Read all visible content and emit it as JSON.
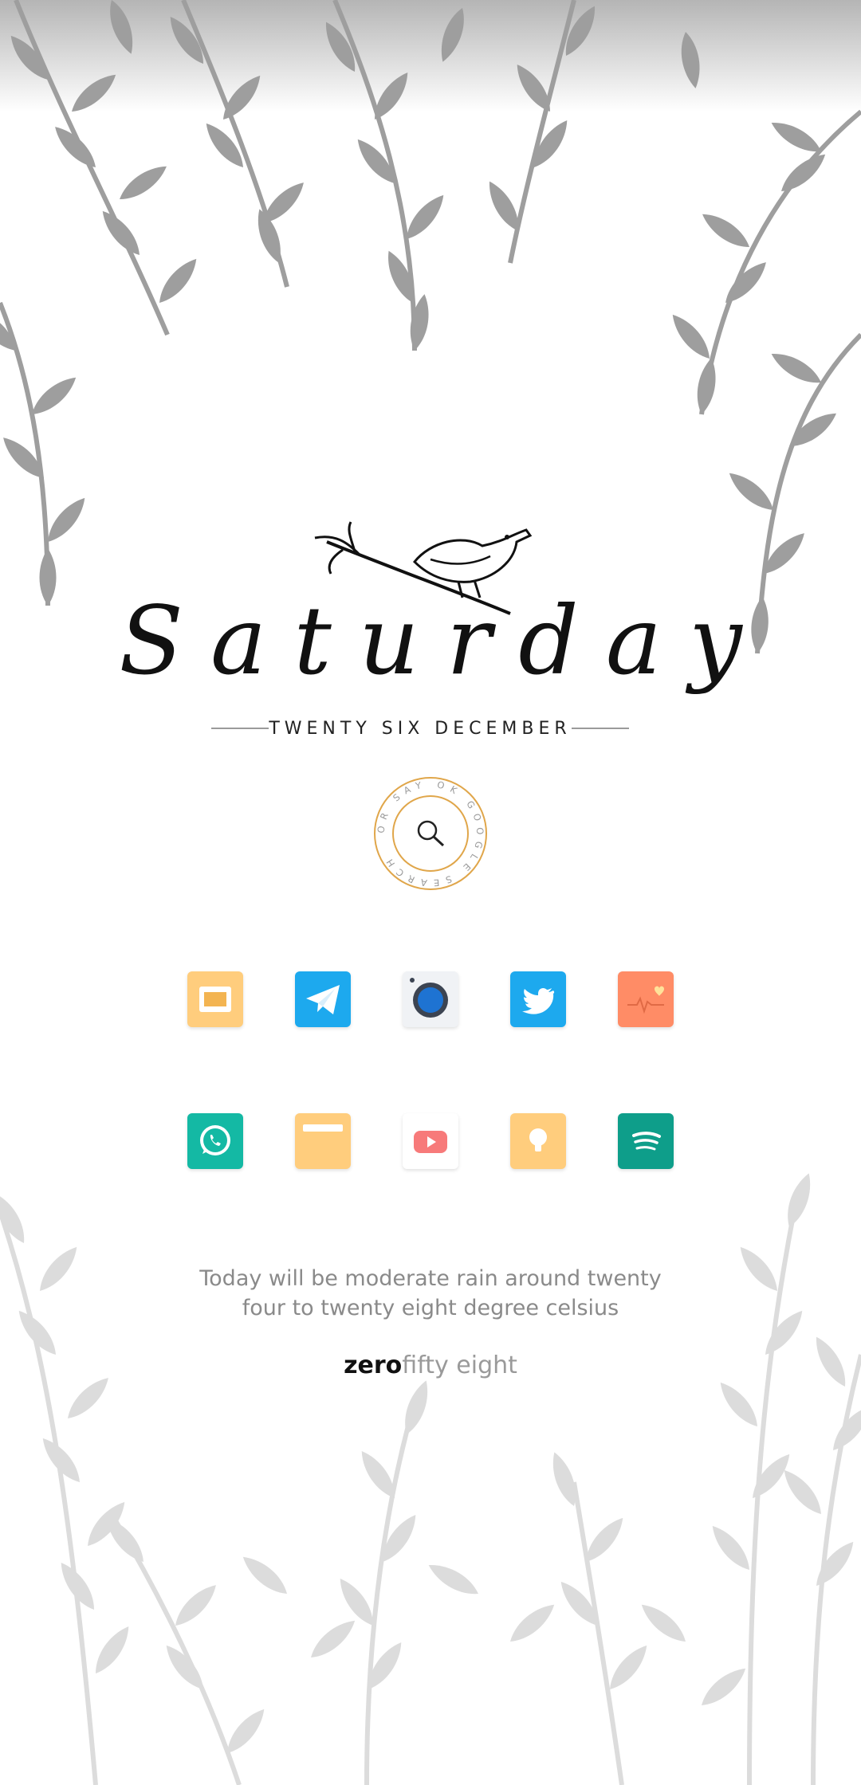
{
  "home": {
    "day": "Saturday",
    "date": "TWENTY SIX DECEMBER",
    "search_ring_text": "OR SAY OK GOOGLE SEARCH",
    "weather_line1": "Today will be moderate rain around twenty",
    "weather_line2": "four to twenty eight degree celsius",
    "time_hour": "zero",
    "time_minute": "fifty eight"
  },
  "apps_row1": [
    {
      "name": "slides-app-icon",
      "bg": "#FFCD7D",
      "icon": "presentation-icon"
    },
    {
      "name": "telegram-app-icon",
      "bg": "#1DA9EE",
      "icon": "paper-plane-icon"
    },
    {
      "name": "camera-app-icon",
      "bg": "#F0F2F5",
      "icon": "camera-lens-icon"
    },
    {
      "name": "twitter-app-icon",
      "bg": "#1DA9EE",
      "icon": "bird-icon"
    },
    {
      "name": "health-app-icon",
      "bg": "#FF8C66",
      "icon": "heart-pulse-icon"
    }
  ],
  "apps_row2": [
    {
      "name": "whatsapp-app-icon",
      "bg": "#14B9A4",
      "icon": "phone-bubble-icon"
    },
    {
      "name": "files-app-icon",
      "bg": "#FFCD7D",
      "icon": "folder-icon"
    },
    {
      "name": "youtube-app-icon",
      "bg": "#FFFFFF",
      "icon": "play-icon"
    },
    {
      "name": "tips-app-icon",
      "bg": "#FFCD7D",
      "icon": "lightbulb-icon"
    },
    {
      "name": "spotify-app-icon",
      "bg": "#0E9E8A",
      "icon": "sound-waves-icon"
    }
  ],
  "colors": {
    "foliage_dark": "#9E9E9E",
    "foliage_light": "#DCDCDC",
    "search_ring": "#E0A64A",
    "text_muted": "#8A8A8A"
  }
}
